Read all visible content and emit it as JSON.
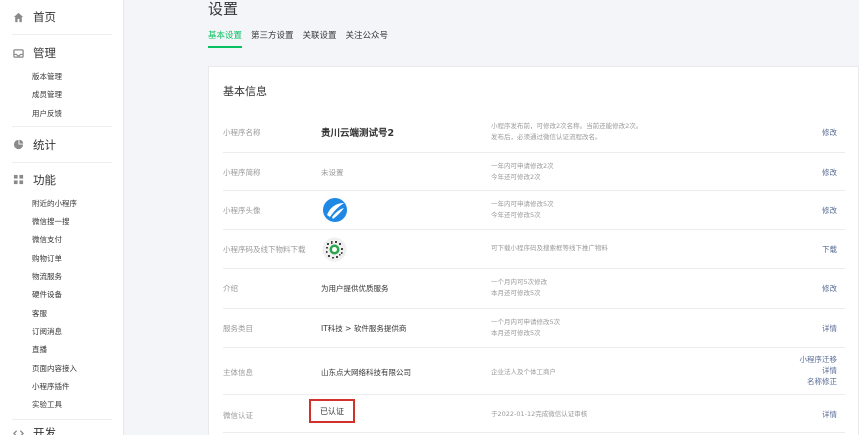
{
  "sidebar": {
    "home": "首页",
    "manage": "管理",
    "manage_items": [
      "版本管理",
      "成员管理",
      "用户反馈"
    ],
    "stats": "统计",
    "features": "功能",
    "feature_items": [
      "附近的小程序",
      "微信搜一搜",
      "微信支付",
      "购物订单",
      "物流服务",
      "硬件设备",
      "客服",
      "订阅消息",
      "直播",
      "页面内容接入",
      "小程序插件",
      "实验工具"
    ],
    "dev": "开发"
  },
  "page": {
    "title": "设置",
    "tabs": [
      "基本设置",
      "第三方设置",
      "关联设置",
      "关注公众号"
    ]
  },
  "basic": {
    "title": "基本信息",
    "rows": [
      {
        "label": "小程序名称",
        "value": "贵川云端测试号2",
        "desc1": "小程序发布前，可修改2次名称。当前还能修改2次。",
        "desc2": "发布后，必须通过微信认证流程改名。",
        "action": "修改"
      },
      {
        "label": "小程序简称",
        "value": "未设置",
        "desc1": "一年内可申请修改2次",
        "desc2": "今年还可修改2次",
        "action": "修改"
      },
      {
        "label": "小程序头像",
        "desc1": "一年内可申请修改5次",
        "desc2": "今年还可修改5次",
        "action": "修改"
      },
      {
        "label": "小程序码及线下物料下载",
        "desc1": "可下载小程序码及搜索框等线下推广物料",
        "action": "下载"
      },
      {
        "label": "介绍",
        "value": "为用户提供优质服务",
        "desc1": "一个月内可5次修改",
        "desc2": "本月还可修改5次",
        "action": "修改"
      },
      {
        "label": "服务类目",
        "value": "IT科技 > 软件服务提供商",
        "desc1": "一个月内可申请修改5次",
        "desc2": "本月还可修改5次",
        "action": "详情"
      },
      {
        "label": "主体信息",
        "value": "山东点大网络科技有限公司",
        "desc1": "企业法人及个体工商户",
        "actions": [
          "小程序迁移",
          "详情",
          "名称修正"
        ]
      },
      {
        "label": "微信认证",
        "value": "已认证",
        "desc1": "于2022-01-12完成微信认证审核",
        "action": "详情"
      }
    ]
  },
  "colors": {
    "accent": "#07c160",
    "link": "#576b95",
    "highlight": "#d3322c"
  }
}
